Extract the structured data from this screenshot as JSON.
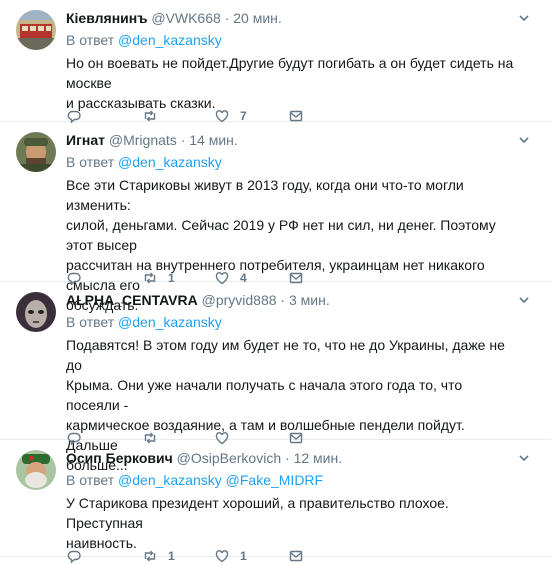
{
  "tweets": [
    {
      "name": "Кiевлянинъ",
      "handle": "@VWK668",
      "dot": "·",
      "time": "20 мин.",
      "reply_prefix": "В ответ",
      "mentions": [
        "@den_kazansky"
      ],
      "lines": [
        "Но он воевать не пойдет.Другие будут погибать а он будет сидеть на москве",
        "и рассказывать сказки."
      ],
      "reply_count": "",
      "retweet_count": "",
      "like_count": "7"
    },
    {
      "name": "Игнат",
      "handle": "@Mrignats",
      "dot": "·",
      "time": "14 мин.",
      "reply_prefix": "В ответ",
      "mentions": [
        "@den_kazansky"
      ],
      "lines": [
        "Все эти Стариковы живут в 2013 году, когда они что-то могли изменить:",
        "силой, деньгами. Сейчас 2019 у РФ нет ни сил, ни денег. Поэтому этот высер",
        "рассчитан на внутреннего потребителя, украинцам нет никакого смысла его",
        "обсуждать."
      ],
      "reply_count": "",
      "retweet_count": "1",
      "like_count": "4"
    },
    {
      "name": "ALPHA_CENTAVRA",
      "handle": "@pryvid888",
      "dot": "·",
      "time": "3 мин.",
      "reply_prefix": "В ответ",
      "mentions": [
        "@den_kazansky"
      ],
      "lines": [
        "Подавятся! В этом году им будет не то, что не до Украины, даже не до",
        "Крыма. Они уже начали получать с начала этого года то, что посеяли -",
        "кармическое воздаяние, а там и волшебные пендели пойдут. Дальше",
        "больше..."
      ],
      "reply_count": "",
      "retweet_count": "",
      "like_count": ""
    },
    {
      "name": "Осип Беркович",
      "handle": "@OsipBerkovich",
      "dot": "·",
      "time": "12 мин.",
      "reply_prefix": "В ответ",
      "mentions": [
        "@den_kazansky",
        "@Fake_MIDRF"
      ],
      "lines": [
        "У Старикова президент хороший, а правительство плохое. Преступная",
        "наивность."
      ],
      "reply_count": "",
      "retweet_count": "1",
      "like_count": "1"
    }
  ],
  "icons": {
    "reply": "reply-icon",
    "retweet": "retweet-icon",
    "like": "heart-icon",
    "dm": "envelope-icon",
    "menu": "chevron-down-icon"
  },
  "colors": {
    "link": "#1da1f2",
    "secondary": "#657786",
    "text": "#14171a",
    "divider": "#e6ecf0"
  }
}
